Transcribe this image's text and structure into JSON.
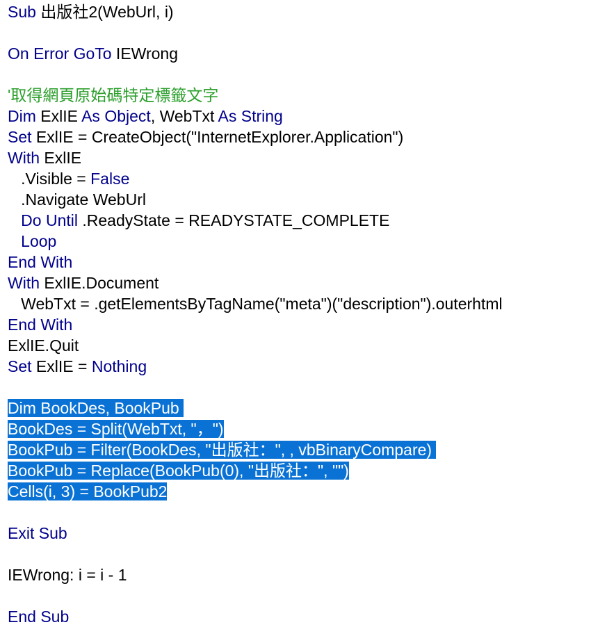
{
  "colors": {
    "keyword": "#00008b",
    "comment": "#2d9f2d",
    "plain": "#000000",
    "selection_bg": "#0a72d4",
    "selection_fg": "#ffffff",
    "background": "#ffffff"
  },
  "lines": [
    {
      "tokens": [
        {
          "t": "Sub",
          "k": "kw"
        },
        {
          "t": " 出版社2(WebUrl, i)",
          "k": "pl"
        }
      ]
    },
    {
      "tokens": []
    },
    {
      "tokens": [
        {
          "t": "On Error GoTo",
          "k": "kw"
        },
        {
          "t": " IEWrong",
          "k": "pl"
        }
      ]
    },
    {
      "tokens": []
    },
    {
      "tokens": [
        {
          "t": "'取得網頁原始碼特定標籤文字",
          "k": "cm"
        }
      ]
    },
    {
      "tokens": [
        {
          "t": "Dim",
          "k": "kw"
        },
        {
          "t": " ExlIE ",
          "k": "pl"
        },
        {
          "t": "As Object",
          "k": "kw"
        },
        {
          "t": ", WebTxt ",
          "k": "pl"
        },
        {
          "t": "As String",
          "k": "kw"
        }
      ]
    },
    {
      "tokens": [
        {
          "t": "Set",
          "k": "kw"
        },
        {
          "t": " ExlIE = CreateObject(\"InternetExplorer.Application\")",
          "k": "pl"
        }
      ]
    },
    {
      "tokens": [
        {
          "t": "With",
          "k": "kw"
        },
        {
          "t": " ExlIE",
          "k": "pl"
        }
      ]
    },
    {
      "tokens": [
        {
          "t": "   .Visible = ",
          "k": "pl"
        },
        {
          "t": "False",
          "k": "kw"
        }
      ]
    },
    {
      "tokens": [
        {
          "t": "   .Navigate WebUrl",
          "k": "pl"
        }
      ]
    },
    {
      "tokens": [
        {
          "t": "   ",
          "k": "pl"
        },
        {
          "t": "Do Until",
          "k": "kw"
        },
        {
          "t": " .ReadyState = READYSTATE_COMPLETE",
          "k": "pl"
        }
      ]
    },
    {
      "tokens": [
        {
          "t": "   ",
          "k": "pl"
        },
        {
          "t": "Loop",
          "k": "kw"
        }
      ]
    },
    {
      "tokens": [
        {
          "t": "End With",
          "k": "kw"
        }
      ]
    },
    {
      "tokens": [
        {
          "t": "With",
          "k": "kw"
        },
        {
          "t": " ExlIE.Document",
          "k": "pl"
        }
      ]
    },
    {
      "tokens": [
        {
          "t": "   WebTxt = .getElementsByTagName(\"meta\")(\"description\").outerhtml",
          "k": "pl"
        }
      ]
    },
    {
      "tokens": [
        {
          "t": "End With",
          "k": "kw"
        }
      ]
    },
    {
      "tokens": [
        {
          "t": "ExlIE.Quit",
          "k": "pl"
        }
      ]
    },
    {
      "tokens": [
        {
          "t": "Set",
          "k": "kw"
        },
        {
          "t": " ExlIE = ",
          "k": "pl"
        },
        {
          "t": "Nothing",
          "k": "kw"
        }
      ]
    },
    {
      "tokens": []
    },
    {
      "selected": true,
      "tokens": [
        {
          "t": "Dim BookDes, BookPub ",
          "k": "pl"
        }
      ]
    },
    {
      "selected": true,
      "tokens": [
        {
          "t": "BookDes = Split(WebTxt, \"，\")",
          "k": "pl"
        }
      ]
    },
    {
      "selected": true,
      "tokens": [
        {
          "t": "BookPub = Filter(BookDes, \"出版社：\", , vbBinaryCompare) ",
          "k": "pl"
        }
      ]
    },
    {
      "selected": true,
      "tokens": [
        {
          "t": "BookPub = Replace(BookPub(0), \"出版社：\", \"\")",
          "k": "pl"
        }
      ]
    },
    {
      "selected": true,
      "tokens": [
        {
          "t": "Cells(i, 3) = BookPub2",
          "k": "pl"
        }
      ]
    },
    {
      "tokens": []
    },
    {
      "tokens": [
        {
          "t": "Exit Sub",
          "k": "kw"
        }
      ]
    },
    {
      "tokens": []
    },
    {
      "tokens": [
        {
          "t": "IEWrong: i = i - 1",
          "k": "pl"
        }
      ]
    },
    {
      "tokens": []
    },
    {
      "tokens": [
        {
          "t": "End Sub",
          "k": "kw"
        }
      ]
    }
  ]
}
